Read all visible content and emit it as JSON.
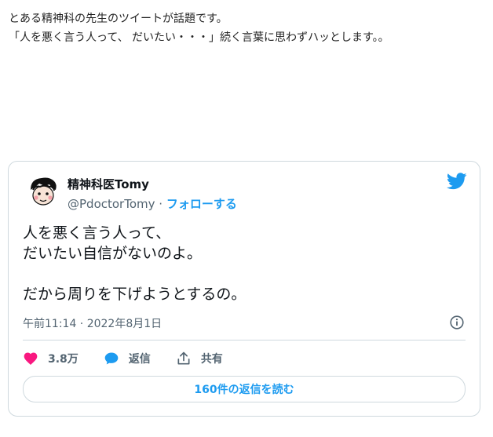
{
  "article": {
    "line1": "とある精神科の先生のツイートが話題です。",
    "line2": "「人を悪く言う人って、 だいたい・・・」続く言葉に思わずハッとします。。"
  },
  "tweet": {
    "author_name": "精神科医Tomy",
    "handle": "@PdoctorTomy",
    "separator": "·",
    "follow_label": "フォローする",
    "text_lines": [
      "人を悪く言う人って、",
      "だいたい自信がないのよ。",
      "だから周りを下げようとするの。"
    ],
    "timestamp": "午前11:14 · 2022年8月1日",
    "likes_count": "3.8万",
    "reply_label": "返信",
    "share_label": "共有",
    "read_replies_label": "160件の返信を読む",
    "accent_color": "#1d9bf0",
    "like_color": "#f91880",
    "icons": {
      "brand": "twitter-bird-icon",
      "info": "info-icon",
      "like": "heart-icon",
      "reply": "speech-bubble-icon",
      "share": "share-arrow-icon"
    }
  }
}
